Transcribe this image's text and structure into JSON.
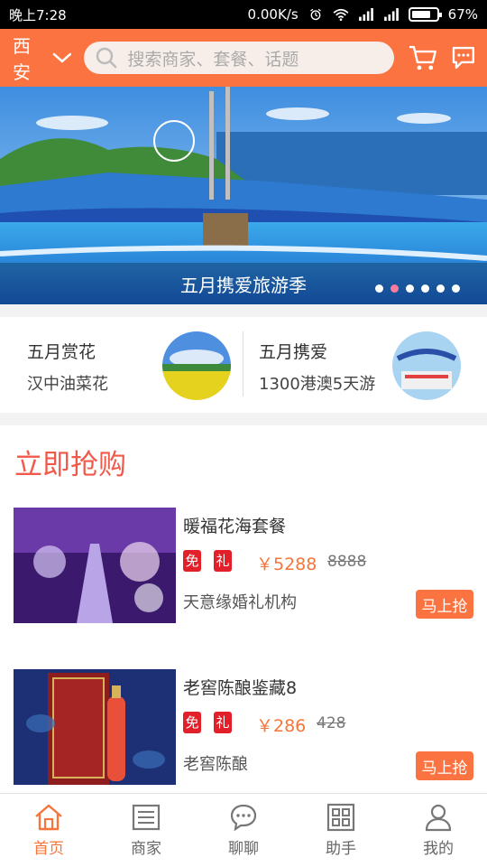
{
  "status_bar": {
    "time": "晚上7:28",
    "speed": "0.00K/s",
    "battery": "67%"
  },
  "header": {
    "city": "西安",
    "search_placeholder": "搜索商家、套餐、话题"
  },
  "banner": {
    "caption": "五月携爱旅游季",
    "dot_count": 6,
    "active_dot": 1
  },
  "promos": [
    {
      "title": "五月赏花",
      "subtitle": "汉中油菜花"
    },
    {
      "title": "五月携爱",
      "subtitle": "1300港澳5天游"
    }
  ],
  "sale": {
    "title": "立即抢购",
    "products": [
      {
        "name": "暖福花海套餐",
        "tag1": "免",
        "tag2": "礼",
        "price": "￥5288",
        "original_price": "8888",
        "shop": "天意缘婚礼机构",
        "buy_label": "马上抢"
      },
      {
        "name": "老窖陈酿鉴藏8",
        "tag1": "免",
        "tag2": "礼",
        "price": "￥286",
        "original_price": "428",
        "shop": "老窖陈酿",
        "buy_label": "马上抢"
      }
    ]
  },
  "nav": [
    {
      "label": "首页",
      "icon": "home-icon",
      "active": true
    },
    {
      "label": "商家",
      "icon": "list-icon",
      "active": false
    },
    {
      "label": "聊聊",
      "icon": "chat-icon",
      "active": false
    },
    {
      "label": "助手",
      "icon": "grid-icon",
      "active": false
    },
    {
      "label": "我的",
      "icon": "user-icon",
      "active": false
    }
  ],
  "colors": {
    "accent": "#fa7340",
    "price": "#f5763a",
    "sale_title": "#f05a4a",
    "tag": "#e2202a"
  }
}
